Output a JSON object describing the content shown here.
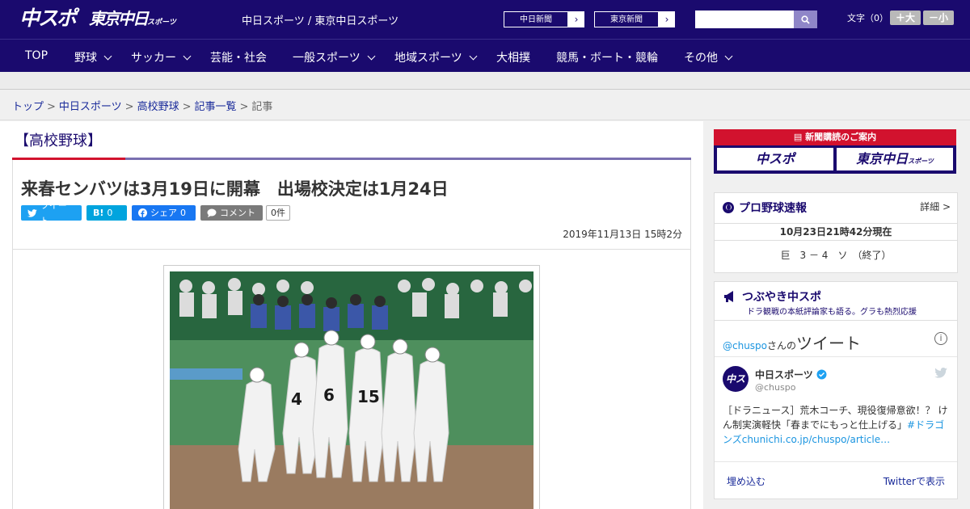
{
  "header": {
    "logo_chuspo": "中スポ",
    "logo_tokyo": "東京中日",
    "logo_tokyo_sub": "スポーツ",
    "site_names": "中日スポーツ / 東京中日スポーツ",
    "ext_links": [
      {
        "label": "中日新聞"
      },
      {
        "label": "東京新聞"
      }
    ],
    "search_placeholder": "",
    "fontsize_label": "文字（0）",
    "fontsize_up": "＋大",
    "fontsize_down": "－小"
  },
  "nav": [
    {
      "label": "TOP",
      "dropdown": false
    },
    {
      "label": "野球",
      "dropdown": true
    },
    {
      "label": "サッカー",
      "dropdown": true
    },
    {
      "label": "芸能・社会",
      "dropdown": false
    },
    {
      "label": "一般スポーツ",
      "dropdown": true
    },
    {
      "label": "地域スポーツ",
      "dropdown": true
    },
    {
      "label": "大相撲",
      "dropdown": false
    },
    {
      "label": "競馬・ボート・競輪",
      "dropdown": false
    },
    {
      "label": "その他",
      "dropdown": true
    }
  ],
  "breadcrumb": [
    "トップ",
    "中日スポーツ",
    "高校野球",
    "記事一覧",
    "記事"
  ],
  "article": {
    "category": "【高校野球】",
    "headline": "来春センバツは3月19日に開幕　出場校決定は1月24日",
    "share": {
      "tweet": "ツイート",
      "hatena": "B!",
      "hatena_count": "0",
      "facebook": "シェア",
      "facebook_count": "0",
      "comment": "コメント",
      "comment_count": "0件"
    },
    "date": "2019年11月13日 15時2分"
  },
  "sidebar": {
    "subscription_title": "新聞購読のご案内",
    "sub_logo_1": "中スポ",
    "sub_logo_2": "東京中日",
    "sub_logo_2_small": "スポーツ",
    "baseball": {
      "title": "プロ野球速報",
      "more": "詳細 >",
      "timestamp": "10月23日21時42分現在",
      "score": "巨　3 － 4　ソ　（終了）"
    },
    "tweets": {
      "title": "つぶやき中スポ",
      "subtitle": "ドラ観戦の本紙評論家も語る。グラも熱烈応援",
      "handle_prefix": "@chuspo",
      "handle_suffix": "さんの",
      "tweet_label": "ツイート",
      "info": "i",
      "account_name": "中日スポーツ",
      "account_handle": "@chuspo",
      "avatar_text": "中スポ",
      "tweet_text": "［ドラニュース］荒木コーチ、現役復帰意欲！？ けん制実演軽快「春までにもっと仕上げる」",
      "tweet_hashtag": "#ドラゴンズ",
      "tweet_link": "chunichi.co.jp/chuspo/article…",
      "embed": "埋め込む",
      "view_on_twitter": "Twitterで表示"
    }
  },
  "colors": {
    "brand_navy": "#1a0a6e",
    "accent_red": "#d2122e",
    "twitter": "#1da1f2",
    "facebook": "#1877f2",
    "hatena": "#00a4de"
  }
}
